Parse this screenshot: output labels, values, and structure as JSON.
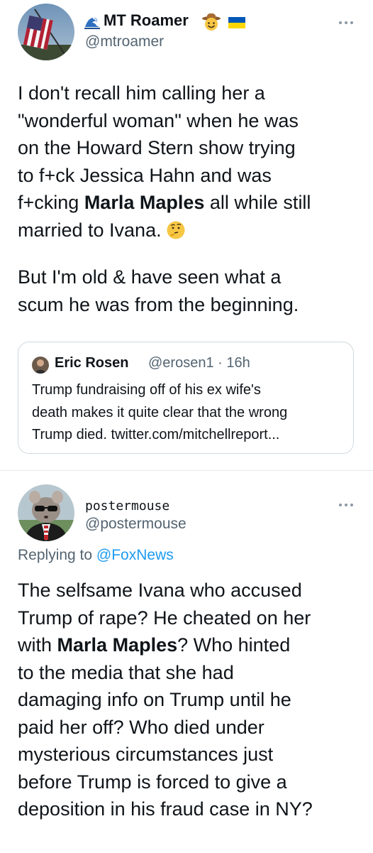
{
  "tweet1": {
    "display_name": "MT Roamer",
    "handle": "@mtroamer",
    "para1_lines": [
      [
        "I don't recall him calling her a",
        "",
        ""
      ],
      [
        "\"wonderful woman\" when he was",
        "",
        ""
      ],
      [
        "on the Howard Stern show trying",
        "",
        ""
      ],
      [
        "to f+ck Jessica Hahn and was",
        "",
        ""
      ],
      [
        "f+cking ",
        "Marla Maples",
        " all while still"
      ],
      [
        "married to Ivana.",
        "",
        ""
      ]
    ],
    "para2_lines": [
      "But I'm old & have seen what a",
      "scum he was from the beginning."
    ],
    "quote": {
      "name": "Eric Rosen",
      "meta": "@erosen1 · 16h",
      "lines": [
        "Trump fundraising off of his ex wife's",
        "death makes it quite clear that the wrong",
        "Trump died. twitter.com/mitchellreport..."
      ]
    }
  },
  "tweet2": {
    "display_name": "postermouse",
    "handle": "@postermouse",
    "replying_prefix": "Replying to ",
    "replying_mention": "@FoxNews",
    "para_lines": [
      [
        "The selfsame Ivana who accused",
        "",
        ""
      ],
      [
        "Trump of rape? He cheated on her",
        "",
        ""
      ],
      [
        "with ",
        "Marla Maples",
        "? Who hinted"
      ],
      [
        "to the media that she had",
        "",
        ""
      ],
      [
        "damaging info on Trump until he",
        "",
        ""
      ],
      [
        "paid her off? Who died under",
        "",
        ""
      ],
      [
        "mysterious circumstances just",
        "",
        ""
      ],
      [
        "before Trump is forced to give a",
        "",
        ""
      ],
      [
        "deposition in his fraud case in NY?",
        "",
        ""
      ]
    ]
  },
  "colors": {
    "text": "#0f1419",
    "secondary": "#536471",
    "link": "#1d9bf0",
    "border": "#cfd9de"
  },
  "icons": [
    "water-wave-icon",
    "cowboy-hat-face-icon",
    "ukraine-flag-icon",
    "thinking-face-icon",
    "more-options-icon"
  ]
}
